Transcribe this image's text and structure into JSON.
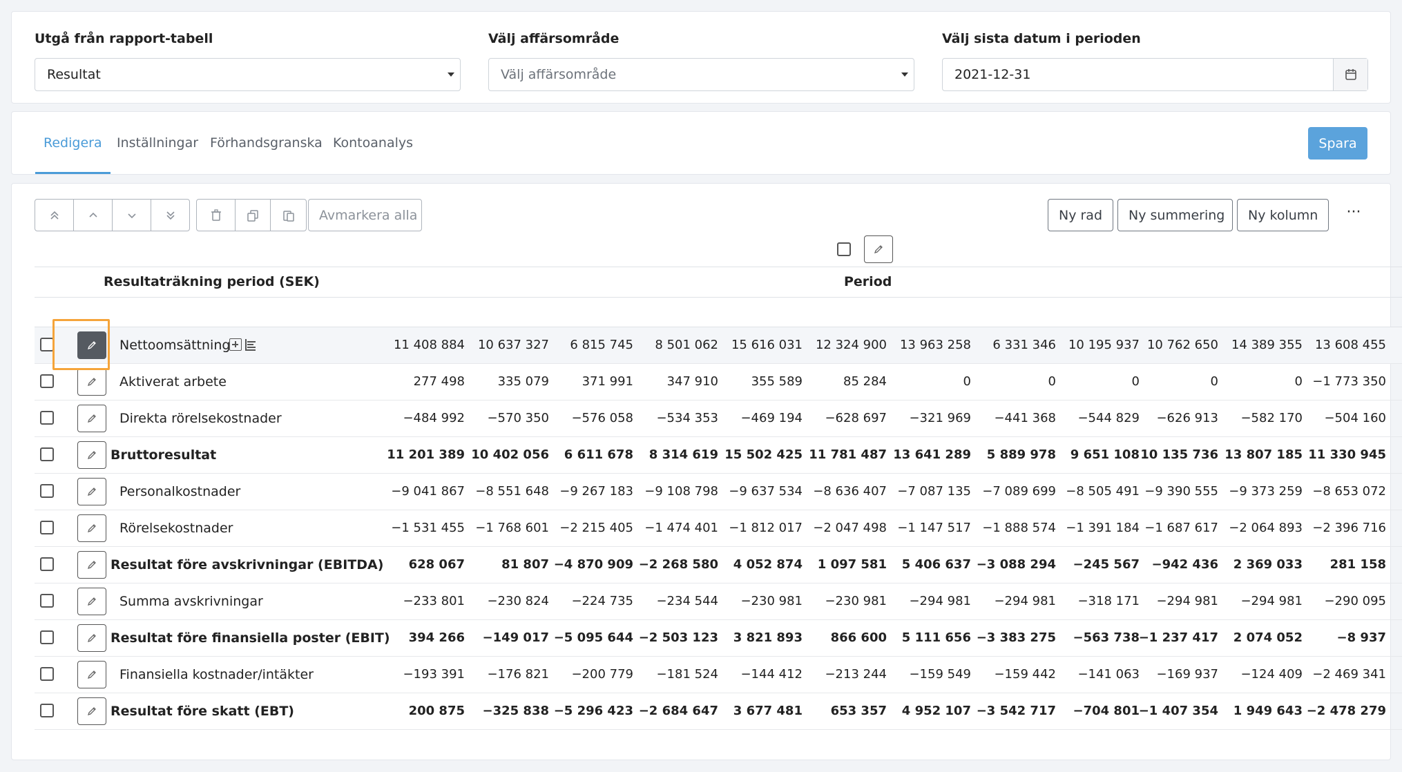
{
  "filters": {
    "report_table": {
      "label": "Utgå från rapport-tabell",
      "value": "Resultat"
    },
    "business_area": {
      "label": "Välj affärsområde",
      "placeholder": "Välj affärsområde"
    },
    "period_end": {
      "label": "Välj sista datum i perioden",
      "value": "2021-12-31"
    }
  },
  "tabs": [
    {
      "label": "Redigera",
      "active": true
    },
    {
      "label": "Inställningar"
    },
    {
      "label": "Förhandsgranska"
    },
    {
      "label": "Kontoanalys"
    }
  ],
  "save_label": "Spara",
  "toolbar": {
    "deselect_all": "Avmarkera alla",
    "new_row": "Ny rad",
    "new_sum": "Ny summering",
    "new_column": "Ny kolumn",
    "more": "···"
  },
  "table": {
    "header_label": "Resultaträkning period (SEK)",
    "header_period": "Period",
    "rows": [
      {
        "label": "Nettoomsättning",
        "bold": false,
        "values": [
          "11 408 884",
          "10 637 327",
          "6 815 745",
          "8 501 062",
          "15 616 031",
          "12 324 900",
          "13 963 258",
          "6 331 346",
          "10 195 937",
          "10 762 650",
          "14 389 355",
          "13 608 455"
        ]
      },
      {
        "label": "Aktiverat arbete",
        "bold": false,
        "values": [
          "277 498",
          "335 079",
          "371 991",
          "347 910",
          "355 589",
          "85 284",
          "0",
          "0",
          "0",
          "0",
          "0",
          "−1 773 350"
        ]
      },
      {
        "label": "Direkta rörelsekostnader",
        "bold": false,
        "values": [
          "−484 992",
          "−570 350",
          "−576 058",
          "−534 353",
          "−469 194",
          "−628 697",
          "−321 969",
          "−441 368",
          "−544 829",
          "−626 913",
          "−582 170",
          "−504 160"
        ]
      },
      {
        "label": "Bruttoresultat",
        "bold": true,
        "values": [
          "11 201 389",
          "10 402 056",
          "6 611 678",
          "8 314 619",
          "15 502 425",
          "11 781 487",
          "13 641 289",
          "5 889 978",
          "9 651 108",
          "10 135 736",
          "13 807 185",
          "11 330 945"
        ]
      },
      {
        "label": "Personalkostnader",
        "bold": false,
        "values": [
          "−9 041 867",
          "−8 551 648",
          "−9 267 183",
          "−9 108 798",
          "−9 637 534",
          "−8 636 407",
          "−7 087 135",
          "−7 089 699",
          "−8 505 491",
          "−9 390 555",
          "−9 373 259",
          "−8 653 072"
        ]
      },
      {
        "label": "Rörelsekostnader",
        "bold": false,
        "values": [
          "−1 531 455",
          "−1 768 601",
          "−2 215 405",
          "−1 474 401",
          "−1 812 017",
          "−2 047 498",
          "−1 147 517",
          "−1 888 574",
          "−1 391 184",
          "−1 687 617",
          "−2 064 893",
          "−2 396 716"
        ]
      },
      {
        "label": "Resultat före avskrivningar (EBITDA)",
        "bold": true,
        "values": [
          "628 067",
          "81 807",
          "−4 870 909",
          "−2 268 580",
          "4 052 874",
          "1 097 581",
          "5 406 637",
          "−3 088 294",
          "−245 567",
          "−942 436",
          "2 369 033",
          "281 158"
        ]
      },
      {
        "label": "Summa avskrivningar",
        "bold": false,
        "values": [
          "−233 801",
          "−230 824",
          "−224 735",
          "−234 544",
          "−230 981",
          "−230 981",
          "−294 981",
          "−294 981",
          "−318 171",
          "−294 981",
          "−294 981",
          "−290 095"
        ]
      },
      {
        "label": "Resultat före finansiella poster (EBIT)",
        "bold": true,
        "values": [
          "394 266",
          "−149 017",
          "−5 095 644",
          "−2 503 123",
          "3 821 893",
          "866 600",
          "5 111 656",
          "−3 383 275",
          "−563 738",
          "−1 237 417",
          "2 074 052",
          "−8 937"
        ]
      },
      {
        "label": "Finansiella kostnader/intäkter",
        "bold": false,
        "values": [
          "−193 391",
          "−176 821",
          "−200 779",
          "−181 524",
          "−144 412",
          "−213 244",
          "−159 549",
          "−159 442",
          "−141 063",
          "−169 937",
          "−124 409",
          "−2 469 341"
        ]
      },
      {
        "label": "Resultat före skatt (EBT)",
        "bold": true,
        "values": [
          "200 875",
          "−325 838",
          "−5 296 423",
          "−2 684 647",
          "3 677 481",
          "653 357",
          "4 952 107",
          "−3 542 717",
          "−704 801",
          "−1 407 354",
          "1 949 643",
          "−2 478 279"
        ]
      }
    ]
  },
  "colors": {
    "accent": "#4a9bd8",
    "save_button": "#5ba3dc",
    "focus_outline": "#f5a43a"
  }
}
